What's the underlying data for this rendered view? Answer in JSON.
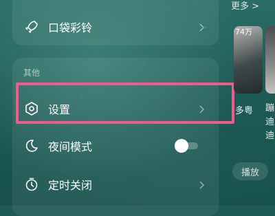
{
  "menu": {
    "ringtone_label": "口袋彩铃",
    "section_other": "其他",
    "settings_label": "设置",
    "night_mode_label": "夜间模式",
    "night_mode_on": false,
    "timer_label": "定时关闭"
  },
  "right_panel": {
    "more_label": "更多 >",
    "play_count": "74万",
    "caption_1": "多粤",
    "caption_2_line1": "蹦迪",
    "caption_2_line2": "迪-",
    "play_button": "播放"
  },
  "icons": {
    "ringtone": "rocket-icon",
    "settings": "hexagon-gear-icon",
    "night_mode": "moon-icon",
    "timer": "stopwatch-icon",
    "chevron": "chevron-right-icon"
  },
  "colors": {
    "highlight": "#ef5b8d",
    "background": "#1f5a55"
  }
}
